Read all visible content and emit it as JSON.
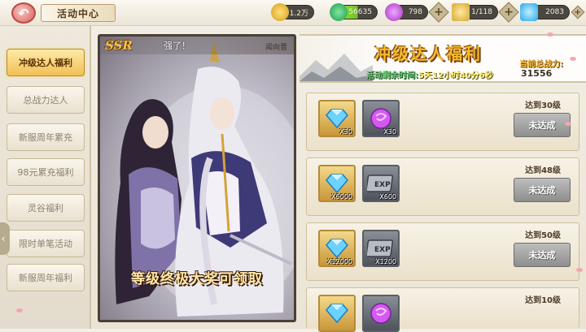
{
  "topbar": {
    "title": "活动中心",
    "resources": [
      {
        "icon": "gold-coin-icon",
        "value": "1.2万"
      },
      {
        "icon": "jade-icon",
        "value": "56635"
      },
      {
        "icon": "purple-orb-icon",
        "value": "798"
      },
      {
        "icon": "stamina-icon",
        "value": "1/118"
      },
      {
        "icon": "diamond-icon",
        "value": "2083"
      }
    ]
  },
  "sidebar": {
    "tabs": [
      {
        "label": "冲级达人福利",
        "active": true
      },
      {
        "label": "总战力达人",
        "active": false
      },
      {
        "label": "新服周年累充",
        "active": false
      },
      {
        "label": "98元累充福利",
        "active": false
      },
      {
        "label": "灵谷福利",
        "active": false
      },
      {
        "label": "限时单笔活动",
        "active": false
      },
      {
        "label": "新服周年福利",
        "active": false
      }
    ]
  },
  "hero": {
    "badge": "SSR",
    "caption": "强了！",
    "sub": "闻向晋",
    "title": "等级终极大奖可领取"
  },
  "header": {
    "title": "冲级达人福利",
    "timer_label": "活动剩余时间:",
    "timer_value": "5天12小时40分6秒",
    "power_label": "当前总战力:",
    "power_value": "31556"
  },
  "rewards": [
    {
      "level_text": "达到30级",
      "status": "未达成",
      "items": [
        {
          "type": "diamond",
          "qty": "X30"
        },
        {
          "type": "purple-orb",
          "qty": "X30"
        }
      ]
    },
    {
      "level_text": "达到48级",
      "status": "未达成",
      "items": [
        {
          "type": "diamond",
          "qty": "X6000"
        },
        {
          "type": "exp-card",
          "qty": "X600"
        }
      ]
    },
    {
      "level_text": "达到50级",
      "status": "未达成",
      "items": [
        {
          "type": "diamond",
          "qty": "X12000"
        },
        {
          "type": "exp-card",
          "qty": "X1200"
        }
      ]
    },
    {
      "level_text": "达到10级",
      "status": "",
      "items": [
        {
          "type": "diamond",
          "qty": ""
        },
        {
          "type": "purple-orb",
          "qty": ""
        }
      ]
    }
  ]
}
